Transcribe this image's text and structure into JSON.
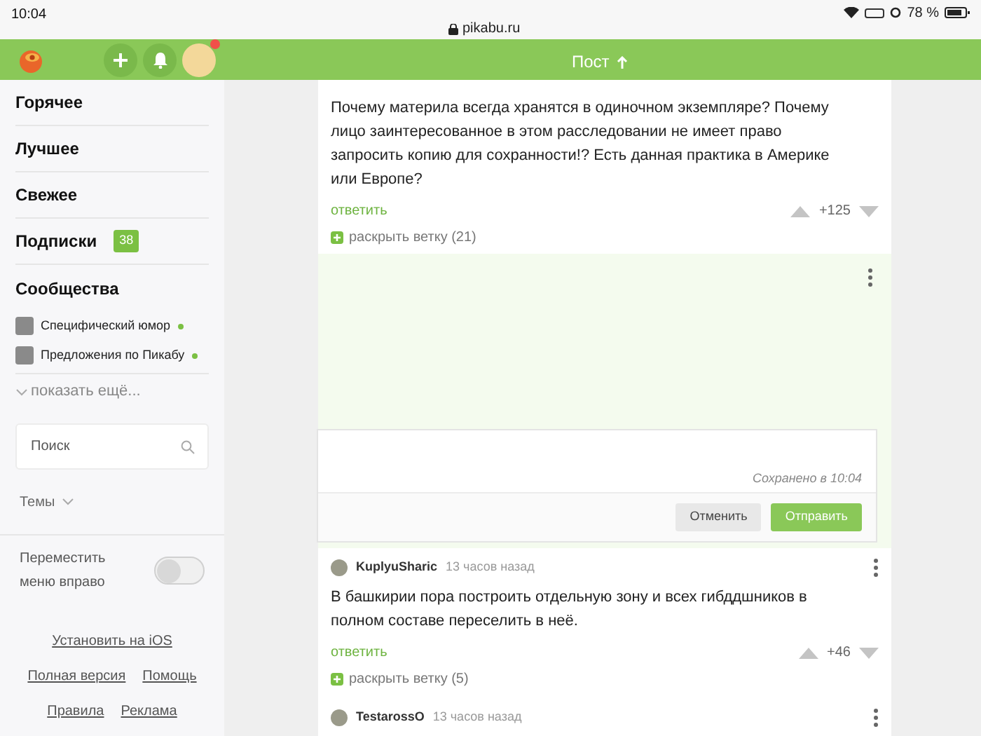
{
  "status_bar": {
    "time": "10:04",
    "url": "pikabu.ru",
    "battery": "78 %"
  },
  "header": {
    "title": "Пост",
    "notification_dot": true
  },
  "sidebar": {
    "nav": [
      {
        "label": "Горячее"
      },
      {
        "label": "Лучшее"
      },
      {
        "label": "Свежее"
      },
      {
        "label": "Подписки",
        "badge": "38"
      },
      {
        "label": "Сообщества"
      }
    ],
    "communities": [
      {
        "name": "Специфический юмор",
        "online": true
      },
      {
        "name": "Предложения по Пикабу",
        "online": true
      }
    ],
    "show_more": "показать ещё...",
    "search": {
      "placeholder": "Поиск"
    },
    "themes": "Темы",
    "move_menu": {
      "label": "Переместить меню вправо",
      "on": false
    },
    "links": [
      [
        "Установить на iOS"
      ],
      [
        "Полная версия",
        "Помощь"
      ],
      [
        "Правила",
        "Реклама"
      ]
    ]
  },
  "comments": [
    {
      "text": "Почему материла всегда хранятся в одиночном экземпляре? Почему лицо заинтересованное в этом расследовании не имеет право запросить копию для сохранности!? Есть данная практика в Америке или Европе?",
      "reply": "ответить",
      "rating": "+125",
      "expand": "раскрыть ветку (21)"
    }
  ],
  "reply_form": {
    "saved": "Сохранено в 10:04",
    "cancel": "Отменить",
    "submit": "Отправить"
  },
  "comments_after": [
    {
      "author": "KuplyuSharic",
      "time": "13 часов назад",
      "text": "В башкирии пора построить отдельную зону и всех гибддшников в полном составе переселить в неё.",
      "reply": "ответить",
      "rating": "+46",
      "expand": "раскрыть ветку (5)"
    },
    {
      "author": "TestarossO",
      "time": "13 часов назад"
    }
  ]
}
